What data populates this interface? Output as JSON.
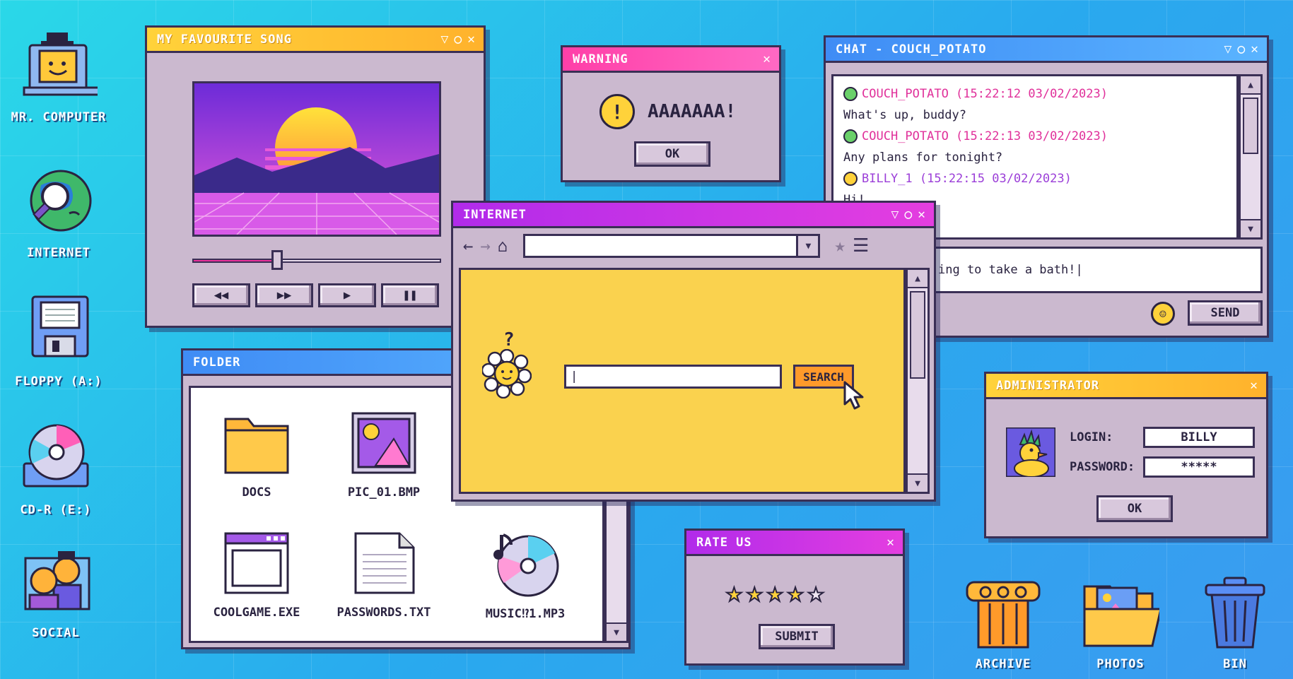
{
  "desktop": {
    "icons_left": [
      {
        "label": "MR. COMPUTER",
        "icon": "computer-icon"
      },
      {
        "label": "INTERNET",
        "icon": "globe-magnifier-icon"
      },
      {
        "label": "FLOPPY (A:)",
        "icon": "floppy-disk-icon"
      },
      {
        "label": "CD-R (E:)",
        "icon": "cd-drive-icon"
      },
      {
        "label": "SOCIAL",
        "icon": "social-people-icon"
      }
    ],
    "icons_bottom": [
      {
        "label": "ARCHIVE",
        "icon": "archive-column-icon"
      },
      {
        "label": "PHOTOS",
        "icon": "photos-folder-icon"
      },
      {
        "label": "BIN",
        "icon": "trash-bin-icon"
      }
    ]
  },
  "music_window": {
    "title": "MY FAVOURITE SONG",
    "progress": 0.34,
    "controls": [
      "rewind-icon",
      "fast-forward-icon",
      "play-icon",
      "pause-icon"
    ]
  },
  "warning_window": {
    "title": "WARNING",
    "message": "AAAAAAA!",
    "ok_label": "OK"
  },
  "chat_window": {
    "title": "CHAT - COUCH_POTATO",
    "messages": [
      {
        "header": "COUCH_POTATO (15:22:12 03/02/2023)",
        "text": "What's up, buddy?"
      },
      {
        "header": "COUCH_POTATO (15:22:13 03/02/2023)",
        "text": "Any plans for tonight?"
      },
      {
        "header": "BILLY_1 (15:22:15 03/02/2023)",
        "text": "Hi!"
      }
    ],
    "input_value": "ing to take a bath!|",
    "send_label": "SEND"
  },
  "internet_window": {
    "title": "INTERNET",
    "address_value": "",
    "search_value": "|",
    "search_label": "SEARCH",
    "question_mark": "?"
  },
  "folder_window": {
    "title": "FOLDER",
    "files": [
      {
        "name": "DOCS",
        "icon": "folder-icon"
      },
      {
        "name": "PIC_01.BMP",
        "icon": "image-file-icon"
      },
      {
        "name": "COOLGAME.EXE",
        "icon": "exe-window-icon"
      },
      {
        "name": "PASSWORDS.TXT",
        "icon": "text-file-icon"
      },
      {
        "name": "MUSIC⁉1.MP3",
        "icon": "music-cd-icon"
      }
    ]
  },
  "rate_window": {
    "title": "RATE US",
    "rating": 4,
    "max_rating": 5,
    "submit_label": "SUBMIT"
  },
  "admin_window": {
    "title": "ADMINISTRATOR",
    "login_label": "LOGIN:",
    "login_value": "BILLY",
    "password_label": "PASSWORD:",
    "password_value": "*****",
    "ok_label": "OK"
  },
  "colors": {
    "yellow_bar": "#ffd23a",
    "pink_bar": "#ff3fa8",
    "blue_bar": "#3f8cf5",
    "purple_bar": "#b12bea",
    "chat_name": "#e0309a",
    "chat_name_user": "#9b3ed8"
  }
}
